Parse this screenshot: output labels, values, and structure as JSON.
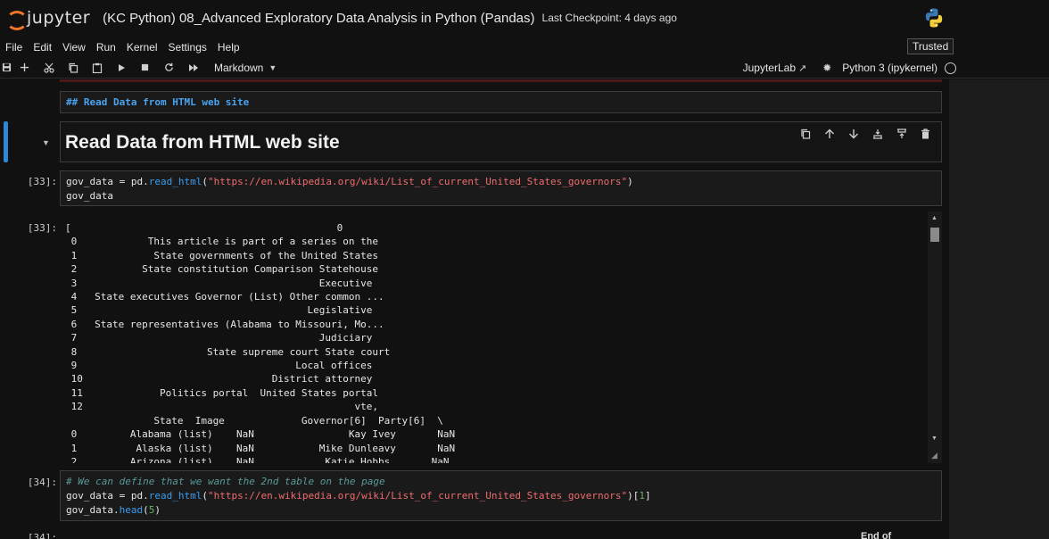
{
  "header": {
    "logo_text": "jupyter",
    "notebook_title": "(KC Python) 08_Advanced Exploratory Data Analysis in Python (Pandas)",
    "checkpoint": "Last Checkpoint: 4 days ago"
  },
  "menu": {
    "items": [
      "File",
      "Edit",
      "View",
      "Run",
      "Kernel",
      "Settings",
      "Help"
    ],
    "trusted": "Trusted"
  },
  "toolbar": {
    "cell_type": "Markdown",
    "jupyterlab": "JupyterLab",
    "kernel_name": "Python 3 (ipykernel)"
  },
  "cells": {
    "md_source": "## Read Data from HTML web site",
    "md_heading": "Read Data from HTML web site",
    "c33": {
      "prompt": "[33]:",
      "line1_var": "gov_data = pd.",
      "line1_fn": "read_html",
      "line1_open": "(",
      "line1_url": "\"https://en.wikipedia.org/wiki/List_of_current_United_States_governors\"",
      "line1_close": ")",
      "line2": "gov_data"
    },
    "out33": {
      "prompt": "[33]:",
      "text": "[                                             0\n 0            This article is part of a series on the\n 1             State governments of the United States\n 2           State constitution Comparison Statehouse\n 3                                         Executive\n 4   State executives Governor (List) Other common ...\n 5                                       Legislative\n 6   State representatives (Alabama to Missouri, Mo...\n 7                                         Judiciary\n 8                      State supreme court State court\n 9                                     Local offices\n 10                                District attorney\n 11             Politics portal  United States portal\n 12                                              vte,\n               State  Image             Governor[6]  Party[6]  \\\n 0         Alabama (list)    NaN                Kay Ivey       NaN\n 1          Alaska (list)    NaN           Mike Dunleavy       NaN\n 2         Arizona (list)    NaN            Katie Hobbs       NaN"
    },
    "c34": {
      "prompt": "[34]:",
      "comment": "# We can define that we want the 2nd table on the page",
      "line2_var": "gov_data = pd.",
      "line2_fn": "read_html",
      "line2_open": "(",
      "line2_url": "\"https://en.wikipedia.org/wiki/List_of_current_United_States_governors\"",
      "line2_close": ")[",
      "line2_idx": "1",
      "line2_end": "]",
      "line3_var": "gov_data.",
      "line3_fn": "head",
      "line3_open": "(",
      "line3_arg": "5",
      "line3_close": ")"
    },
    "next_prompt": "[34]:",
    "bottom_hint": "End of"
  }
}
